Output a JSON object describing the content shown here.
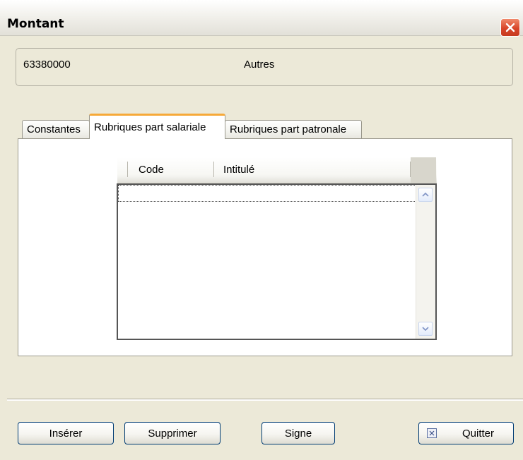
{
  "window": {
    "title": "Montant"
  },
  "header": {
    "code": "63380000",
    "name": "Autres"
  },
  "tabs": [
    {
      "label": "Constantes",
      "active": false
    },
    {
      "label": "Rubriques part salariale",
      "active": true
    },
    {
      "label": "Rubriques part patronale",
      "active": false
    }
  ],
  "grid": {
    "columns": [
      "Code",
      "Intitulé"
    ],
    "rows": []
  },
  "buttons": {
    "inserer": "Insérer",
    "supprimer": "Supprimer",
    "signe": "Signe",
    "quitter": "Quitter"
  },
  "icons": {
    "close": "close-icon",
    "quit": "quit-icon",
    "scroll_up": "chevron-up-icon",
    "scroll_down": "chevron-down-icon"
  },
  "colors": {
    "window_bg": "#ece9d8",
    "active_tab_accent": "#f6a938",
    "close_button": "#d8462a",
    "button_border": "#003c74"
  }
}
